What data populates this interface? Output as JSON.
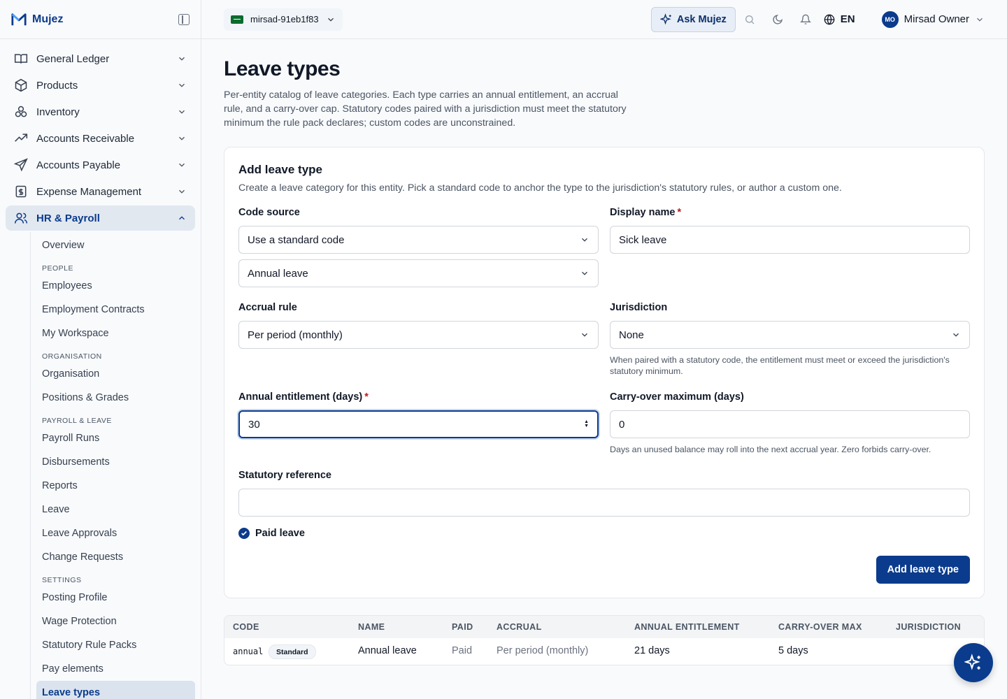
{
  "brand": {
    "name": "Mujez"
  },
  "sidebar": {
    "items": [
      {
        "label": "General Ledger"
      },
      {
        "label": "Products"
      },
      {
        "label": "Inventory"
      },
      {
        "label": "Accounts Receivable"
      },
      {
        "label": "Accounts Payable"
      },
      {
        "label": "Expense Management"
      },
      {
        "label": "HR & Payroll"
      }
    ],
    "hr": {
      "overview": "Overview",
      "people_head": "PEOPLE",
      "employees": "Employees",
      "contracts": "Employment Contracts",
      "workspace": "My Workspace",
      "org_head": "ORGANISATION",
      "organisation": "Organisation",
      "positions": "Positions & Grades",
      "payroll_head": "PAYROLL & LEAVE",
      "payroll_runs": "Payroll Runs",
      "disbursements": "Disbursements",
      "reports": "Reports",
      "leave": "Leave",
      "leave_approvals": "Leave Approvals",
      "change_requests": "Change Requests",
      "settings_head": "SETTINGS",
      "posting_profile": "Posting Profile",
      "wage_protection": "Wage Protection",
      "rule_packs": "Statutory Rule Packs",
      "pay_elements": "Pay elements",
      "leave_types": "Leave types"
    }
  },
  "header": {
    "entity": "mirsad-91eb1f83",
    "ask": "Ask Mujez",
    "lang": "EN",
    "avatar": "MO",
    "user": "Mirsad Owner"
  },
  "page": {
    "title": "Leave types",
    "description": "Per-entity catalog of leave categories. Each type carries an annual entitlement, an accrual rule, and a carry-over cap. Statutory codes paired with a jurisdiction must meet the statutory minimum the rule pack declares; custom codes are unconstrained."
  },
  "form": {
    "title": "Add leave type",
    "subtitle": "Create a leave category for this entity. Pick a standard code to anchor the type to the jurisdiction's statutory rules, or author a custom one.",
    "code_source_label": "Code source",
    "code_source_value": "Use a standard code",
    "standard_code_value": "Annual leave",
    "display_name_label": "Display name",
    "display_name_value": "Sick leave",
    "accrual_label": "Accrual rule",
    "accrual_value": "Per period (monthly)",
    "jurisdiction_label": "Jurisdiction",
    "jurisdiction_value": "None",
    "jurisdiction_hint": "When paired with a statutory code, the entitlement must meet or exceed the jurisdiction's statutory minimum.",
    "entitlement_label": "Annual entitlement (days)",
    "entitlement_value": "30",
    "carry_label": "Carry-over maximum (days)",
    "carry_value": "0",
    "carry_hint": "Days an unused balance may roll into the next accrual year. Zero forbids carry-over.",
    "statutory_label": "Statutory reference",
    "statutory_value": "",
    "paid_label": "Paid leave",
    "required_mark": "*",
    "submit": "Add leave type"
  },
  "table": {
    "headers": [
      "CODE",
      "NAME",
      "PAID",
      "ACCRUAL",
      "ANNUAL ENTITLEMENT",
      "CARRY-OVER MAX",
      "JURISDICTION"
    ],
    "rows": [
      {
        "code": "annual",
        "badge": "Standard",
        "name": "Annual leave",
        "paid": "Paid",
        "accrual": "Per period (monthly)",
        "entitlement": "21 days",
        "carry": "5 days",
        "jurisdiction": ""
      }
    ]
  }
}
